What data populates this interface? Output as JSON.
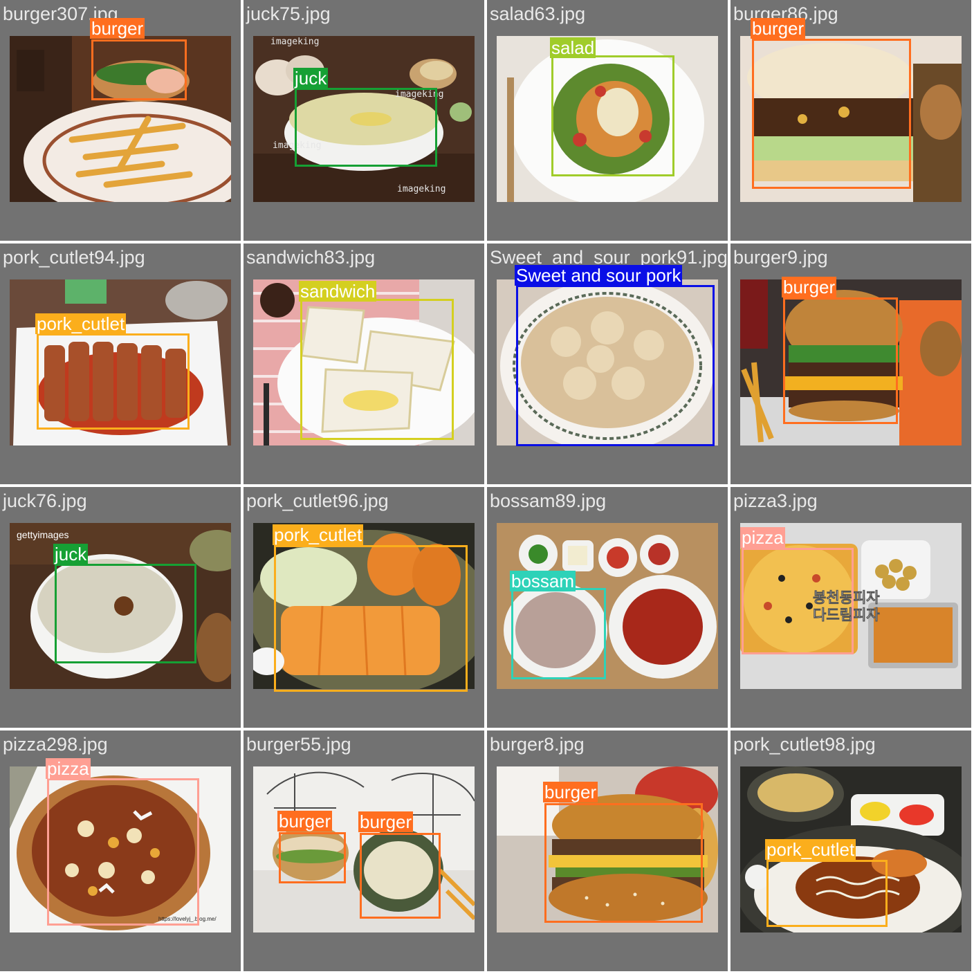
{
  "tiles": [
    {
      "filename": "burger307.jpg",
      "labels": [
        "burger"
      ]
    },
    {
      "filename": "juck75.jpg",
      "labels": [
        "juck"
      ],
      "watermark": "imageking"
    },
    {
      "filename": "salad63.jpg",
      "labels": [
        "salad"
      ]
    },
    {
      "filename": "burger86.jpg",
      "labels": [
        "burger"
      ]
    },
    {
      "filename": "pork_cutlet94.jpg",
      "labels": [
        "pork_cutlet"
      ]
    },
    {
      "filename": "sandwich83.jpg",
      "labels": [
        "sandwich"
      ]
    },
    {
      "filename": "Sweet_and_sour_pork91.jpg",
      "labels": [
        "Sweet and sour pork"
      ]
    },
    {
      "filename": "burger9.jpg",
      "labels": [
        "burger"
      ]
    },
    {
      "filename": "juck76.jpg",
      "labels": [
        "juck"
      ],
      "watermark": "gettyimages"
    },
    {
      "filename": "pork_cutlet96.jpg",
      "labels": [
        "pork_cutlet"
      ]
    },
    {
      "filename": "bossam89.jpg",
      "labels": [
        "bossam"
      ]
    },
    {
      "filename": "pizza3.jpg",
      "labels": [
        "pizza"
      ],
      "overlay_text": [
        "봉천동피자",
        "다드림피자"
      ]
    },
    {
      "filename": "pizza298.jpg",
      "labels": [
        "pizza"
      ],
      "watermark": "https://lovelyj_.blog.me/"
    },
    {
      "filename": "burger55.jpg",
      "labels": [
        "burger",
        "burger"
      ]
    },
    {
      "filename": "burger8.jpg",
      "labels": [
        "burger"
      ]
    },
    {
      "filename": "pork_cutlet98.jpg",
      "labels": [
        "pork_cutlet"
      ]
    }
  ],
  "colors": {
    "burger": "#ff6e1f",
    "juck": "#16a034",
    "salad": "#a0cc2a",
    "pork_cutlet": "#fbae1c",
    "sandwich": "#d4cf20",
    "Sweet and sour pork": "#0a0fe6",
    "bossam": "#2ed2b8",
    "pizza": "#ff9f93"
  }
}
